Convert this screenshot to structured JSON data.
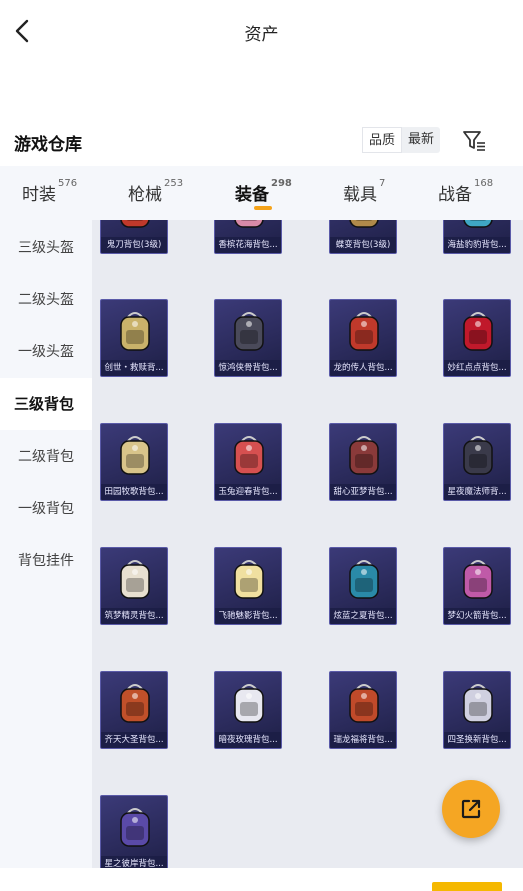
{
  "header": {
    "title": "资产"
  },
  "warehouse": {
    "title": "游戏仓库",
    "sort_quality": "品质",
    "sort_latest": "最新"
  },
  "tabs": [
    {
      "label": "时装",
      "count": "576"
    },
    {
      "label": "枪械",
      "count": "253"
    },
    {
      "label": "装备",
      "count": "298"
    },
    {
      "label": "载具",
      "count": "7"
    },
    {
      "label": "战备",
      "count": "168"
    }
  ],
  "sidebar": {
    "items": [
      {
        "label": "三级头盔"
      },
      {
        "label": "二级头盔"
      },
      {
        "label": "一级头盔"
      },
      {
        "label": "三级背包"
      },
      {
        "label": "二级背包"
      },
      {
        "label": "一级背包"
      },
      {
        "label": "背包挂件"
      }
    ]
  },
  "items": [
    {
      "name": "鬼刀背包(3级)",
      "color": "#c0392b"
    },
    {
      "name": "香槟花海背包...",
      "color": "#d98aa8"
    },
    {
      "name": "蝶变背包(3级)",
      "color": "#b08a4a"
    },
    {
      "name": "海盐豹豹背包...",
      "color": "#3fa7c4"
    },
    {
      "name": "创世・救赎背...",
      "color": "#c9b26a"
    },
    {
      "name": "惊鸿侠骨背包...",
      "color": "#4a4a5a"
    },
    {
      "name": "龙的传人背包...",
      "color": "#c0392b"
    },
    {
      "name": "妙红点点背包...",
      "color": "#c0192b"
    },
    {
      "name": "田园牧歌背包...",
      "color": "#d8c48a"
    },
    {
      "name": "玉兔迎春背包...",
      "color": "#d65050"
    },
    {
      "name": "甜心亚梦背包...",
      "color": "#8a3a3a"
    },
    {
      "name": "星夜魔法师背...",
      "color": "#3a3a4a"
    },
    {
      "name": "筑梦精灵背包...",
      "color": "#e8e0d0"
    },
    {
      "name": "飞驰魅影背包...",
      "color": "#f0e0a0"
    },
    {
      "name": "炫蓝之夏背包...",
      "color": "#2a8aa8"
    },
    {
      "name": "梦幻火箭背包...",
      "color": "#c05aa8"
    },
    {
      "name": "齐天大圣背包...",
      "color": "#c0502a"
    },
    {
      "name": "暗夜玫瑰背包...",
      "color": "#e8e8f0"
    },
    {
      "name": "瑞龙福将背包...",
      "color": "#c04a2a"
    },
    {
      "name": "四圣换新背包...",
      "color": "#d0d0e0"
    },
    {
      "name": "星之彼岸背包...",
      "color": "#5a4aa8"
    }
  ],
  "colors": {
    "accent": "#f5a623",
    "card": "#2e2e62"
  }
}
